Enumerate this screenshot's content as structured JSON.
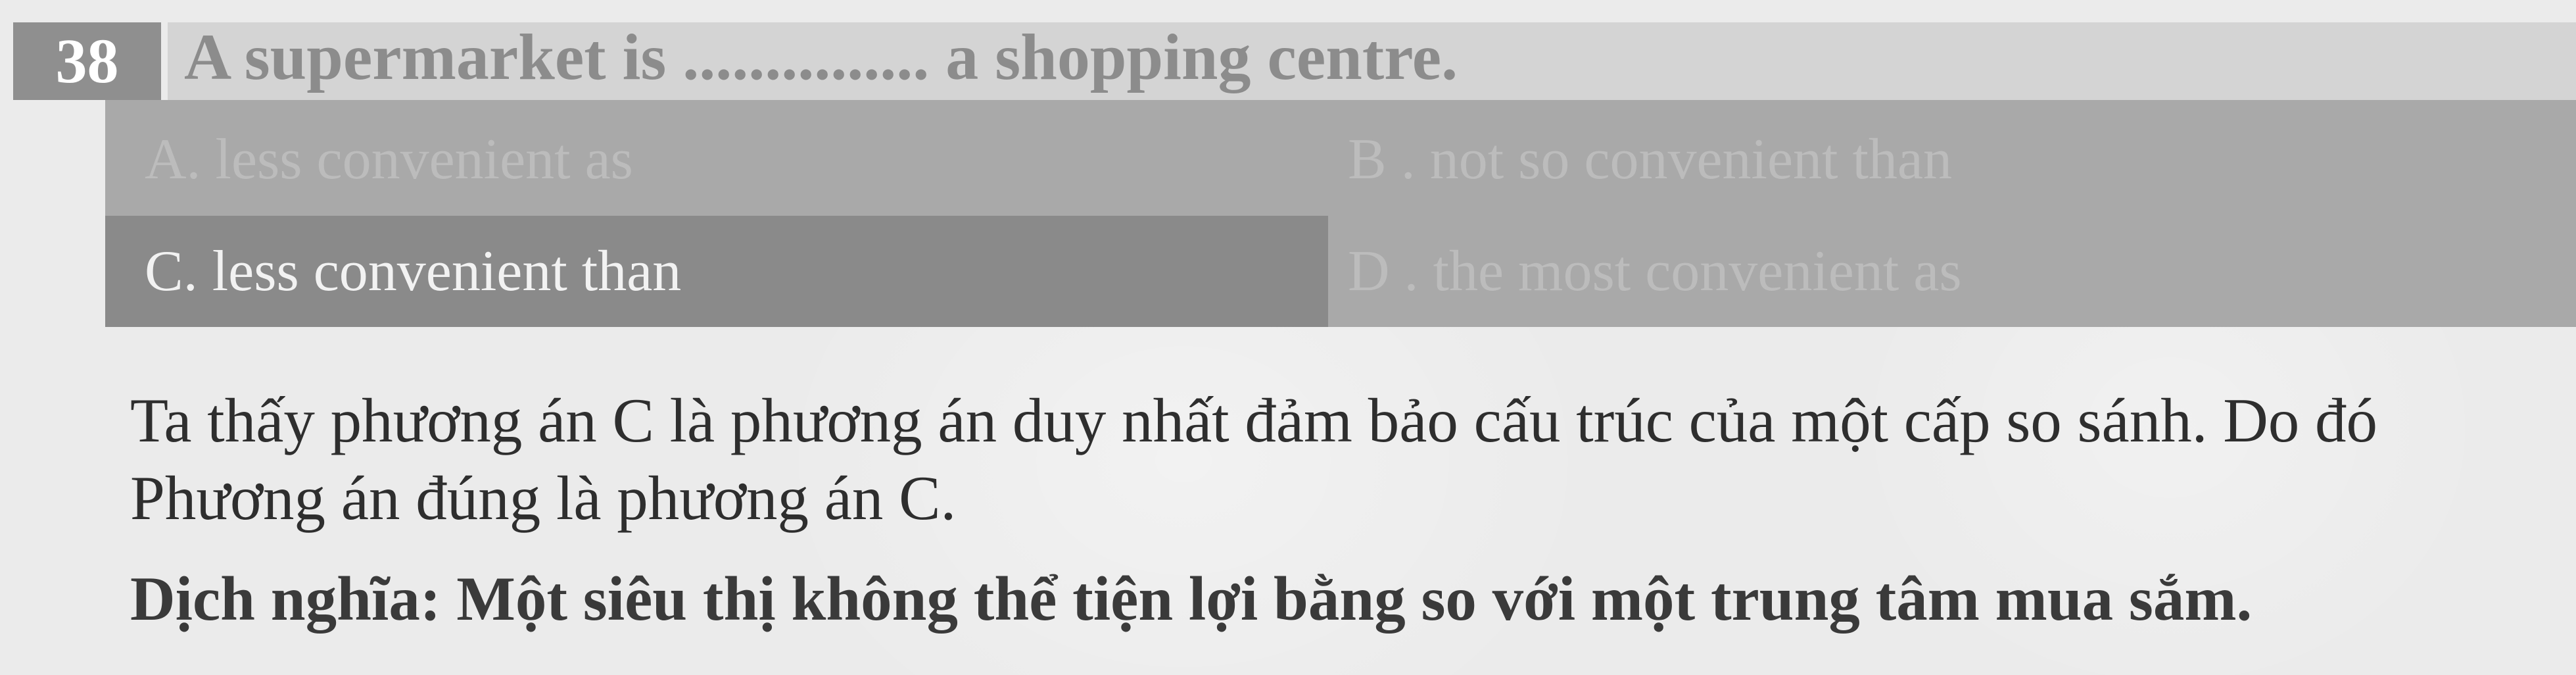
{
  "question": {
    "number": "38",
    "text": "A supermarket is ............... a shopping centre."
  },
  "options": [
    {
      "label": "A. less convenient as"
    },
    {
      "label": "B . not so convenient than"
    },
    {
      "label": "C. less convenient than"
    },
    {
      "label": "D . the most convenient as"
    }
  ],
  "explanation": {
    "line1": "Ta thấy phương án C là phương án duy nhất đảm bảo cấu trúc của một cấp so sánh. Do đó",
    "line2": "Phương án đúng là phương án C."
  },
  "translation": "Dịch nghĩa: Một siêu thị không thể tiện lợi bằng so với một trung tâm mua sắm."
}
